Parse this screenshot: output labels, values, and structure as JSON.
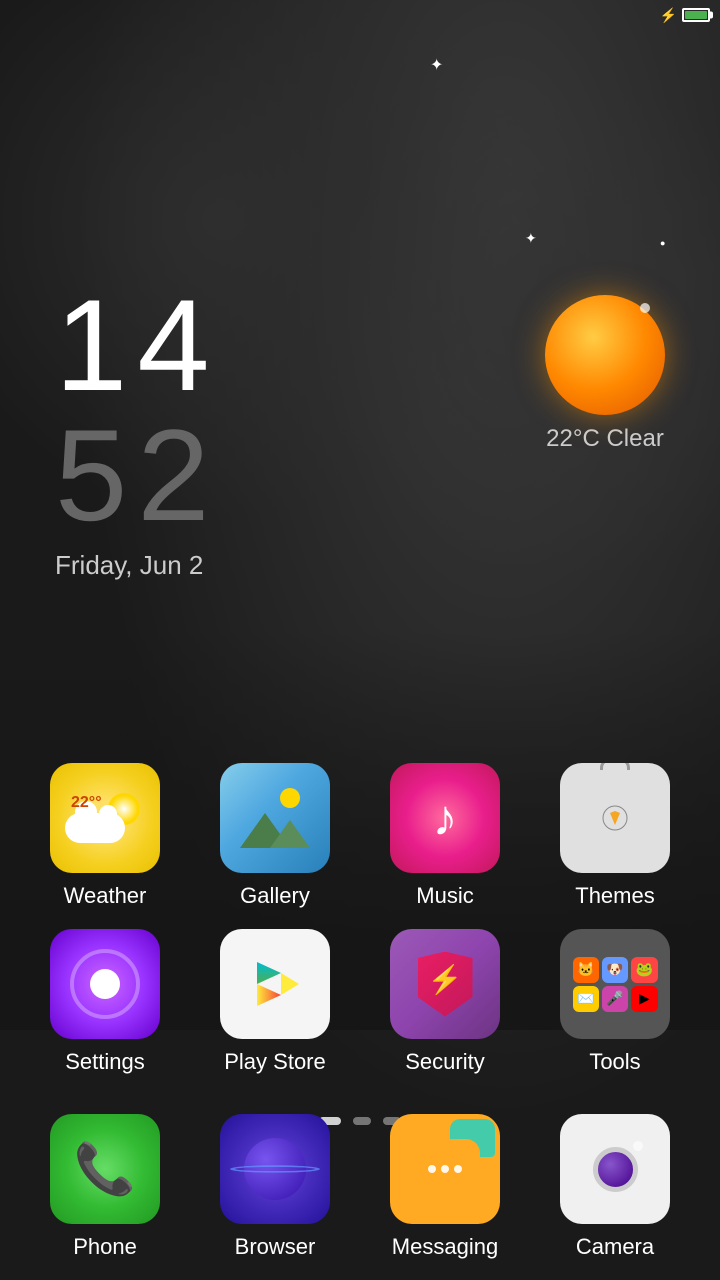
{
  "status_bar": {
    "battery_full": true
  },
  "clock": {
    "hour": "14",
    "minute": "52",
    "date": "Friday, Jun 2"
  },
  "weather": {
    "temp": "22°C",
    "condition": "Clear",
    "label": "22°C Clear"
  },
  "app_rows": [
    [
      {
        "id": "weather",
        "label": "Weather",
        "temp": "22°C°"
      },
      {
        "id": "gallery",
        "label": "Gallery"
      },
      {
        "id": "music",
        "label": "Music"
      },
      {
        "id": "themes",
        "label": "Themes"
      }
    ],
    [
      {
        "id": "settings",
        "label": "Settings"
      },
      {
        "id": "playstore",
        "label": "Play Store"
      },
      {
        "id": "security",
        "label": "Security"
      },
      {
        "id": "tools",
        "label": "Tools"
      }
    ]
  ],
  "dock": [
    {
      "id": "phone",
      "label": "Phone"
    },
    {
      "id": "browser",
      "label": "Browser"
    },
    {
      "id": "messaging",
      "label": "Messaging"
    },
    {
      "id": "camera",
      "label": "Camera"
    }
  ],
  "page_dots": [
    {
      "active": true
    },
    {
      "active": false
    },
    {
      "active": false
    }
  ]
}
